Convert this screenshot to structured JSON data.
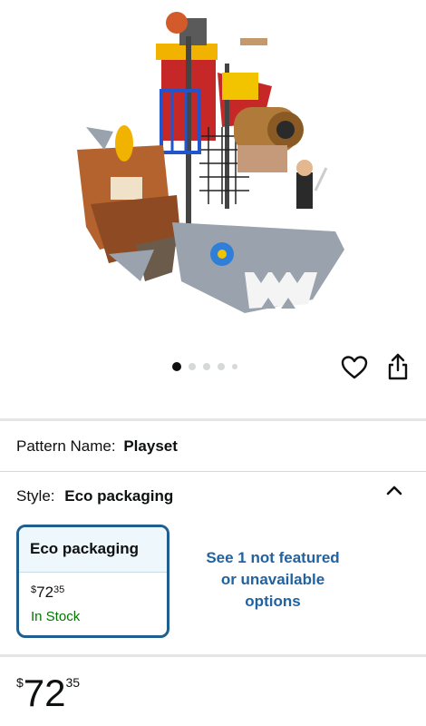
{
  "gallery": {
    "image_icon": "pirate-shark-ship-toy-photo",
    "dots": {
      "count": 5,
      "active_index": 0
    },
    "wishlist_icon": "heart-icon",
    "share_icon": "share-icon"
  },
  "pattern": {
    "label": "Pattern Name:",
    "value": "Playset"
  },
  "style": {
    "label": "Style:",
    "value": "Eco packaging",
    "chevron_icon": "chevron-up-icon"
  },
  "option": {
    "title": "Eco packaging",
    "price_symbol": "$",
    "price_whole": "72",
    "price_fraction": "35",
    "stock": "In Stock"
  },
  "more_options": {
    "line1": "See 1 not featured",
    "line2": "or unavailable",
    "line3": "options"
  },
  "price": {
    "symbol": "$",
    "whole": "72",
    "fraction": "35"
  },
  "colors": {
    "link": "#2162a1",
    "selected_border": "#1e5f8f",
    "in_stock": "#007600"
  }
}
